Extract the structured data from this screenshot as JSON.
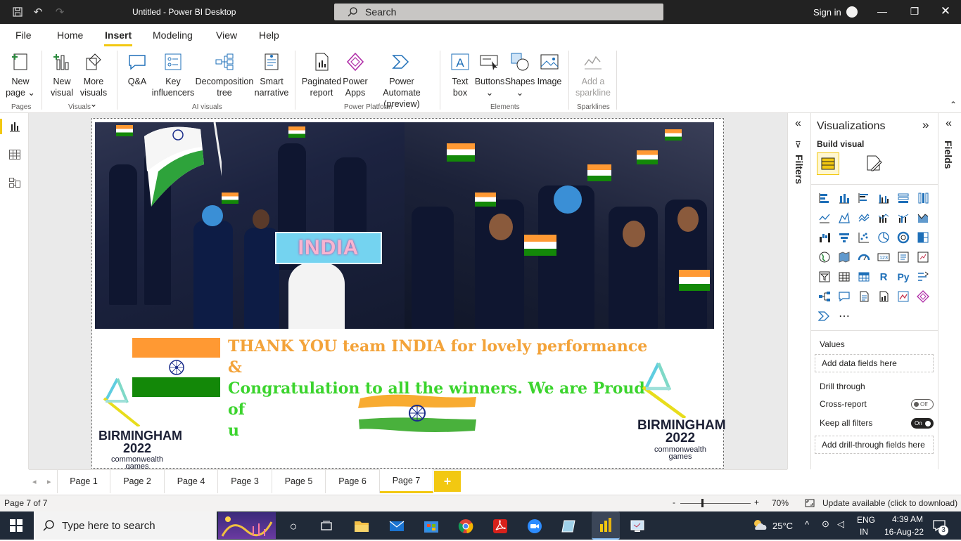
{
  "titlebar": {
    "title": "Untitled - Power BI Desktop",
    "search_placeholder": "Search",
    "signin": "Sign in"
  },
  "menu": [
    "File",
    "Home",
    "Insert",
    "Modeling",
    "View",
    "Help"
  ],
  "menu_active": "Insert",
  "ribbon": {
    "new_page": [
      "New",
      "page"
    ],
    "new_visual": [
      "New",
      "visual"
    ],
    "more_visuals": [
      "More",
      "visuals"
    ],
    "qa": "Q&A",
    "key_influencers": [
      "Key",
      "influencers"
    ],
    "decomposition_tree": [
      "Decomposition",
      "tree"
    ],
    "smart_narrative": [
      "Smart",
      "narrative"
    ],
    "paginated_report": [
      "Paginated",
      "report"
    ],
    "power_apps": [
      "Power",
      "Apps"
    ],
    "power_automate": [
      "Power Automate",
      "(preview)"
    ],
    "text_box": [
      "Text",
      "box"
    ],
    "buttons": "Buttons",
    "shapes": "Shapes",
    "image": "Image",
    "add_sparkline": [
      "Add a",
      "sparkline"
    ],
    "groups": {
      "pages": "Pages",
      "visuals": "Visuals",
      "ai_visuals": "AI visuals",
      "power_platform": "Power Platform",
      "elements": "Elements",
      "sparklines": "Sparklines"
    }
  },
  "report": {
    "sign_text": "INDIA",
    "thanks_line1": "THANK YOU team INDIA for lovely performance &",
    "thanks_line2": "Congratulation to all the winners. We are Proud of",
    "thanks_line3": "u",
    "logo": {
      "line1": "BIRMINGHAM",
      "line2": "2022",
      "line3": "commonwealth",
      "line4": "games"
    }
  },
  "panes": {
    "filters": "Filters",
    "visualizations": "Visualizations",
    "build_visual": "Build visual",
    "fields": "Fields",
    "values_label": "Values",
    "values_placeholder": "Add data fields here",
    "drill_through": "Drill through",
    "cross_report": "Cross-report",
    "cross_report_state": "Off",
    "keep_all_filters": "Keep all filters",
    "keep_all_filters_state": "On",
    "drill_placeholder": "Add drill-through fields here"
  },
  "pages": [
    "Page 1",
    "Page 2",
    "Page 4",
    "Page 3",
    "Page 5",
    "Page 6",
    "Page 7"
  ],
  "active_page": "Page 7",
  "status": {
    "page_count": "Page 7 of 7",
    "zoom": "70%",
    "update": "Update available (click to download)"
  },
  "taskbar": {
    "search_placeholder": "Type here to search",
    "weather": "25°C",
    "lang1": "ENG",
    "lang2": "IN",
    "time": "4:39 AM",
    "date": "16-Aug-22",
    "notifications": "3"
  },
  "colors": {
    "accent": "#f2c811",
    "icon_blue": "#1e6fb8",
    "saffron": "#ff9933",
    "india_green": "#138808",
    "thanks_orange": "#f3a33a",
    "thanks_green": "#3cd42e"
  }
}
